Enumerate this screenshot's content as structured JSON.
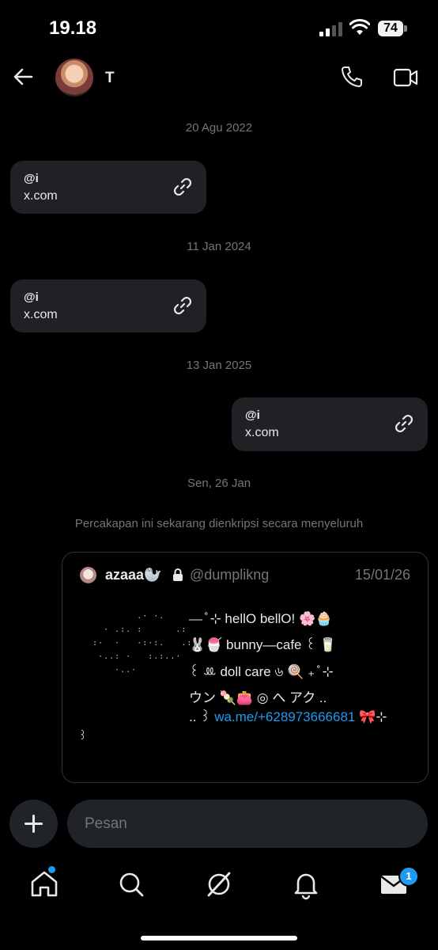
{
  "status_bar": {
    "time": "19.18",
    "battery": "74"
  },
  "header": {
    "contact_name": "T"
  },
  "conversation": {
    "dates": [
      "20 Agu 2022",
      "11 Jan 2024",
      "13 Jan 2025",
      "Sen, 26 Jan"
    ],
    "messages": [
      {
        "handle": "@i",
        "domain": "x.com",
        "direction": "received"
      },
      {
        "handle": "@i",
        "domain": "x.com",
        "direction": "received"
      },
      {
        "handle": "@i",
        "domain": "x.com",
        "direction": "sent"
      }
    ],
    "encryption_note": "Percakapan ini sekarang dienkripsi secara menyeluruh"
  },
  "quoted_post": {
    "author_name": "azaaa🦭",
    "author_handle": "@dumplikng",
    "date": "15/01/26",
    "lines": [
      "⎯⎯ ̊ ⊹ hellO bellO!  🌸🧁",
      "🐰🍧 bunny—cafe  ꒰ 🥛",
      "꒰ ꔛ doll care  ৬ 🍭  ₊ ̊ ⊹",
      "ウン 🍡👛 ◎  へ   アク ..",
      ".. ꒱"
    ],
    "link": "wa.me/+628973666681",
    "link_suffix": "🎀⊹",
    "trailing": "꒱"
  },
  "composer": {
    "placeholder": "Pesan"
  },
  "nav": {
    "messages_badge": "1"
  },
  "colors": {
    "accent": "#1d9bf0",
    "bubble": "#1f2125",
    "background": "#000000"
  }
}
